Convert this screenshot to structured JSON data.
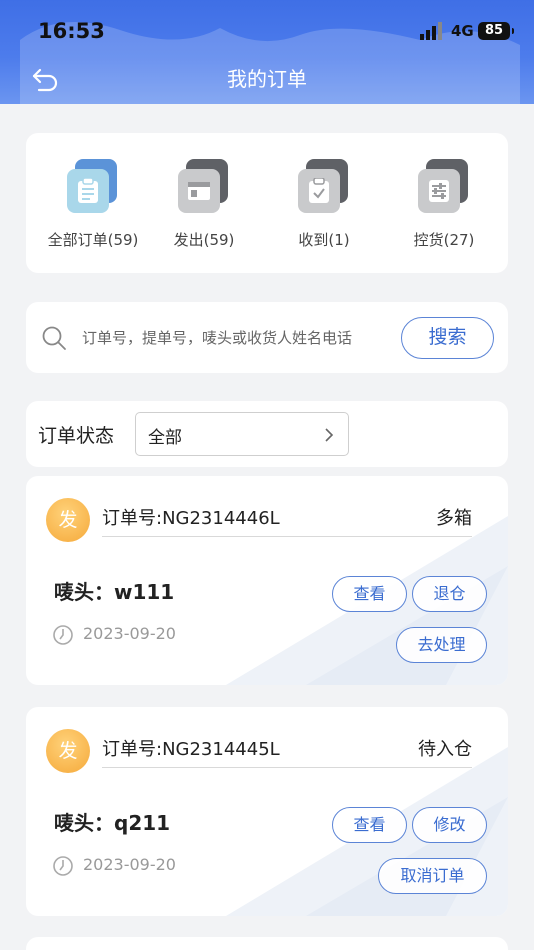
{
  "status_bar": {
    "time": "16:53",
    "network": "4G",
    "battery": "85"
  },
  "header": {
    "title": "我的订单"
  },
  "categories": [
    {
      "label": "全部订单(59)",
      "icon": "clipboard-icon",
      "active": true
    },
    {
      "label": "发出(59)",
      "icon": "window-icon",
      "active": false
    },
    {
      "label": "收到(1)",
      "icon": "check-clipboard-icon",
      "active": false
    },
    {
      "label": "控货(27)",
      "icon": "sliders-icon",
      "active": false
    }
  ],
  "search": {
    "placeholder": "订单号，提单号，唛头或收货人姓名电话",
    "value": "",
    "button_label": "搜索"
  },
  "filter": {
    "label": "订单状态",
    "selected": "全部"
  },
  "orders": [
    {
      "badge": "发",
      "order_no": "订单号:NG2314446L",
      "status": "多箱",
      "mark": "唛头：w111",
      "date": "2023-09-20",
      "buttons": [
        "查看",
        "退仓",
        "去处理"
      ]
    },
    {
      "badge": "发",
      "order_no": "订单号:NG2314445L",
      "status": "待入仓",
      "mark": "唛头：q211",
      "date": "2023-09-20",
      "buttons": [
        "查看",
        "修改",
        "取消订单"
      ]
    }
  ],
  "colors": {
    "header": "#4d7cec",
    "accent": "#3a6cd0",
    "badge": "#f5a93a",
    "active_icon": "#a9d7ea"
  }
}
